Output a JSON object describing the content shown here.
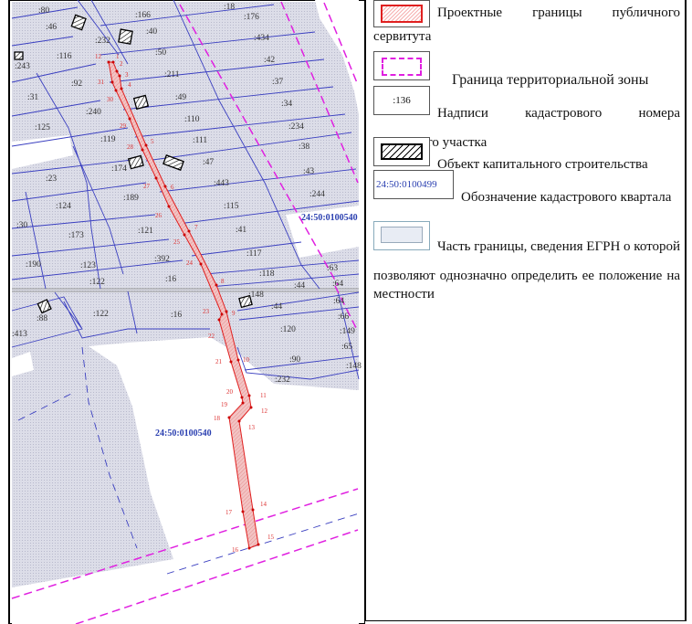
{
  "map": {
    "quarter_labels": [
      "24:50:0100540",
      "24:50:0100540"
    ],
    "parcels": [
      ":80",
      ":46",
      ":166",
      ":40",
      ":18",
      ":176",
      ":434",
      ":232",
      ":116",
      ":50",
      ":243",
      ":211",
      ":42",
      ":92",
      ":37",
      ":31",
      ":49",
      ":34",
      ":240",
      ":110",
      ":234",
      ":125",
      ":119",
      ":111",
      ":38",
      ":174",
      ":47",
      ":43",
      ":23",
      ":443",
      ":244",
      ":189",
      ":124",
      ":115",
      ":30",
      ":173",
      ":121",
      ":41",
      ":117",
      ":190",
      ":123",
      ":392",
      ":63",
      ":118",
      ":122",
      ":16",
      ":44",
      ":64",
      ":148",
      ":64",
      ":44",
      ":88",
      ":122",
      ":16",
      ":66",
      ":120",
      ":413",
      ":149",
      ":65",
      ":90",
      ":148",
      ":232"
    ],
    "points": [
      "1",
      "2",
      "3",
      "4",
      "5",
      "6",
      "7",
      "8",
      "9",
      "10",
      "11",
      "12",
      "13",
      "14",
      "15",
      "16",
      "17",
      "18",
      "19",
      "20",
      "21",
      "22",
      "23",
      "24",
      "25",
      "26",
      "27",
      "28",
      "29",
      "30",
      "31",
      "12"
    ]
  },
  "legend": {
    "items": [
      {
        "text": "Проектные границы публичного сервитута"
      },
      {
        "text": "Граница территориальной зоны"
      },
      {
        "text": "Надписи кадастрового номера земельного участка",
        "sample": ":136"
      },
      {
        "text": "Объект капитального строительства"
      },
      {
        "text": "Обозначение кадастрового квартала",
        "sample": "24:50:0100499"
      },
      {
        "text": "Часть границы, сведения ЕГРН о которой позволяют однозначно определить ее положение на местности"
      }
    ],
    "colors": {
      "servitude": "#e02020",
      "zone": "#e020e0",
      "quarter": "#2a3fb0",
      "parcel_line": "#3a3fc0"
    }
  }
}
